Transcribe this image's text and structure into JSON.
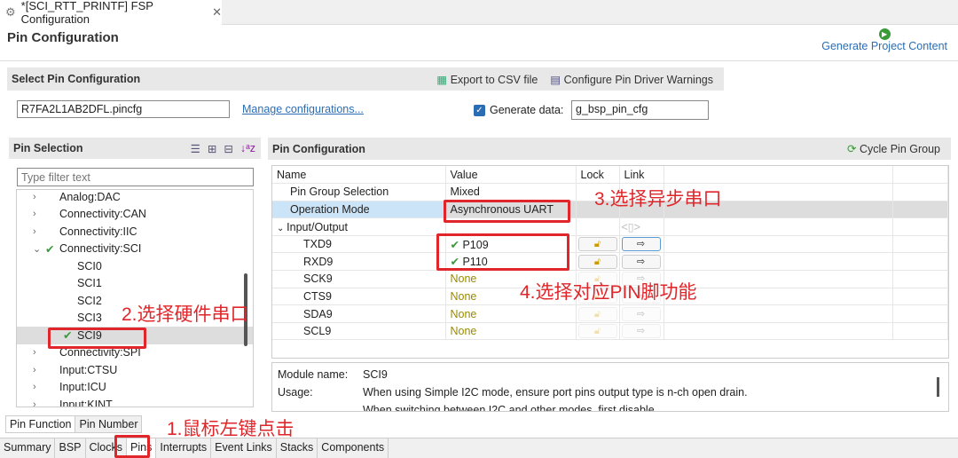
{
  "window": {
    "tab_title": "*[SCI_RTT_PRINTF] FSP Configuration",
    "close": "✕"
  },
  "page_title": "Pin Configuration",
  "generate_button": "Generate Project Content",
  "select_section": {
    "title": "Select Pin Configuration",
    "export": "Export to CSV file",
    "warnings": "Configure Pin Driver Warnings",
    "config_file": "R7FA2L1AB2DFL.pincfg",
    "manage": "Manage configurations...",
    "generate_data_label": "Generate data:",
    "generate_data_checked": true,
    "generate_data_value": "g_bsp_pin_cfg"
  },
  "pin_selection": {
    "title": "Pin Selection",
    "filter_placeholder": "Type filter text",
    "items": [
      {
        "label": "Analog:DAC",
        "level": 0,
        "expander": "›"
      },
      {
        "label": "Connectivity:CAN",
        "level": 0,
        "expander": "›"
      },
      {
        "label": "Connectivity:IIC",
        "level": 0,
        "expander": "›"
      },
      {
        "label": "Connectivity:SCI",
        "level": 0,
        "expander": "⌄",
        "checked": true
      },
      {
        "label": "SCI0",
        "level": 1
      },
      {
        "label": "SCI1",
        "level": 1
      },
      {
        "label": "SCI2",
        "level": 1
      },
      {
        "label": "SCI3",
        "level": 1
      },
      {
        "label": "SCI9",
        "level": 1,
        "checked": true,
        "selected": true
      },
      {
        "label": "Connectivity:SPI",
        "level": 0,
        "expander": "›"
      },
      {
        "label": "Input:CTSU",
        "level": 0,
        "expander": "›"
      },
      {
        "label": "Input:ICU",
        "level": 0,
        "expander": "›"
      },
      {
        "label": "Input:KINT",
        "level": 0,
        "expander": "›"
      }
    ],
    "tabs": [
      "Pin Function",
      "Pin Number"
    ]
  },
  "pin_config": {
    "title": "Pin Configuration",
    "cycle": "Cycle Pin Group",
    "headers": [
      "Name",
      "Value",
      "Lock",
      "Link"
    ],
    "rows": [
      {
        "name": "Pin Group Selection",
        "value": "Mixed",
        "indent": 1
      },
      {
        "name": "Operation Mode",
        "value": "Asynchronous UART",
        "indent": 1,
        "highlight": true
      },
      {
        "name": "Input/Output",
        "value": "",
        "indent": 0,
        "group": true
      },
      {
        "name": "TXD9",
        "value": "P109",
        "indent": 2,
        "ok": true,
        "active": true
      },
      {
        "name": "RXD9",
        "value": "P110",
        "indent": 2,
        "ok": true,
        "active": true
      },
      {
        "name": "SCK9",
        "value": "None",
        "indent": 2
      },
      {
        "name": "CTS9",
        "value": "None",
        "indent": 2
      },
      {
        "name": "SDA9",
        "value": "None",
        "indent": 2
      },
      {
        "name": "SCL9",
        "value": "None",
        "indent": 2
      }
    ],
    "module_label": "Module name:",
    "module_value": "SCI9",
    "usage_label": "Usage:",
    "usage_1": "When using Simple I2C mode, ensure port pins output type is n-ch open drain.",
    "usage_2": "When switching between I2C and other modes, first disable"
  },
  "bottom_tabs": [
    "Summary",
    "BSP",
    "Clocks",
    "Pins",
    "Interrupts",
    "Event Links",
    "Stacks",
    "Components"
  ],
  "annotations": {
    "a1": "1.鼠标左键点击",
    "a2": "2.选择硬件串口",
    "a3": "3.选择异步串口",
    "a4": "4.选择对应PIN脚功能"
  },
  "colors": {
    "annotation": "#e0262a",
    "link": "#2a6db5",
    "check": "#3a9a3a"
  }
}
